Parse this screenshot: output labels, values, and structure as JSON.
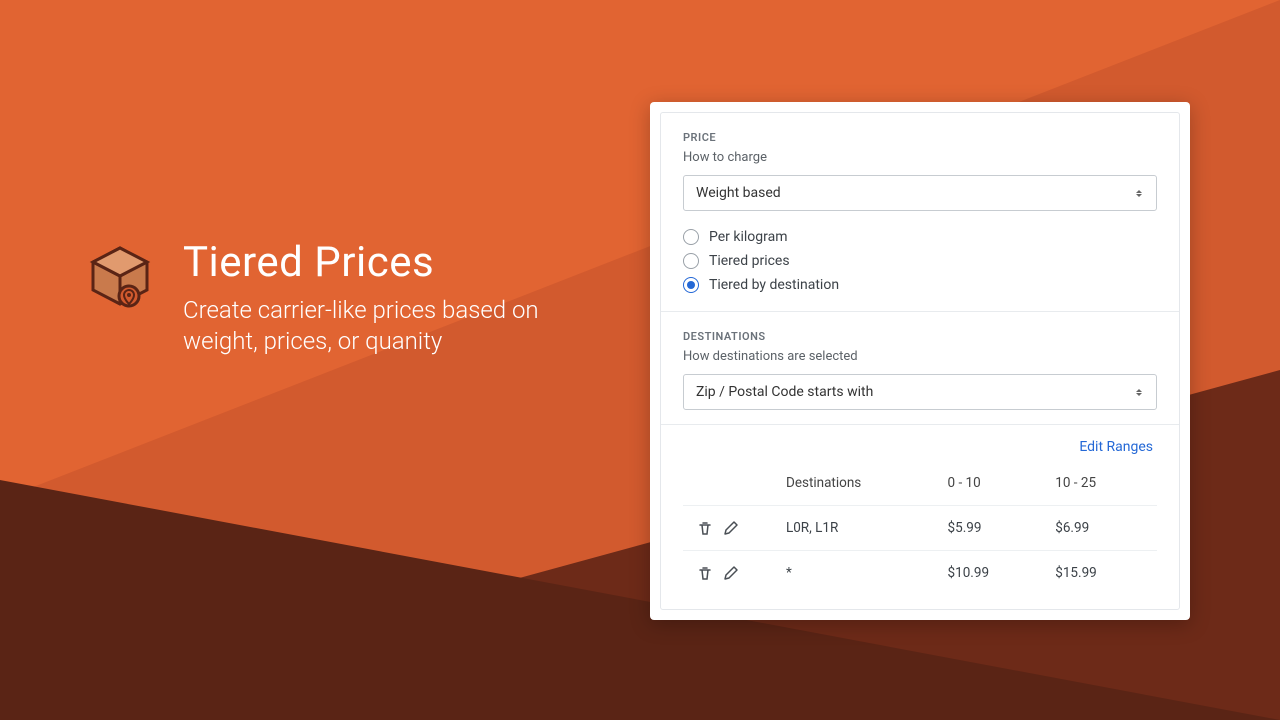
{
  "hero": {
    "title": "Tiered Prices",
    "subtitle": "Create carrier-like prices based on weight, prices, or quanity"
  },
  "price": {
    "section_label": "PRICE",
    "sublabel": "How to charge",
    "select_value": "Weight based",
    "radios": {
      "per_kg": "Per kilogram",
      "tiered": "Tiered prices",
      "by_dest": "Tiered by destination"
    }
  },
  "destinations": {
    "section_label": "DESTINATIONS",
    "sublabel": "How destinations are selected",
    "select_value": "Zip / Postal Code starts with",
    "edit_link": "Edit Ranges",
    "headers": {
      "dest": "Destinations",
      "range1": "0 - 10",
      "range2": "10 - 25"
    },
    "rows": [
      {
        "dest": "L0R, L1R",
        "r1": "$5.99",
        "r2": "$6.99"
      },
      {
        "dest": "*",
        "r1": "$10.99",
        "r2": "$15.99"
      }
    ]
  }
}
